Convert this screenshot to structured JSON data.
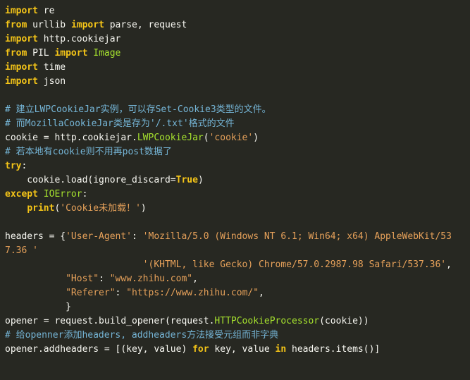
{
  "colors": {
    "background": "#272822",
    "default_text": "#f8f8f2",
    "keyword": "#f5c518",
    "string": "#e6a15a",
    "class_name": "#a6e22e",
    "comment": "#75b5d6"
  },
  "lines": [
    [
      {
        "t": "import",
        "c": "kw"
      },
      {
        "t": " re",
        "c": ""
      }
    ],
    [
      {
        "t": "from",
        "c": "kw"
      },
      {
        "t": " urllib ",
        "c": ""
      },
      {
        "t": "import",
        "c": "kw"
      },
      {
        "t": " parse, request",
        "c": ""
      }
    ],
    [
      {
        "t": "import",
        "c": "kw"
      },
      {
        "t": " http.cookiejar",
        "c": ""
      }
    ],
    [
      {
        "t": "from",
        "c": "kw"
      },
      {
        "t": " PIL ",
        "c": ""
      },
      {
        "t": "import",
        "c": "kw"
      },
      {
        "t": " ",
        "c": ""
      },
      {
        "t": "Image",
        "c": "fn"
      }
    ],
    [
      {
        "t": "import",
        "c": "kw"
      },
      {
        "t": " time",
        "c": ""
      }
    ],
    [
      {
        "t": "import",
        "c": "kw"
      },
      {
        "t": " json",
        "c": ""
      }
    ],
    [],
    [
      {
        "t": "# 建立LWPCookieJar实例，可以存Set-Cookie3类型的文件。",
        "c": "cmt"
      }
    ],
    [
      {
        "t": "# 而MozillaCookieJar类是存为'/.txt'格式的文件",
        "c": "cmt"
      }
    ],
    [
      {
        "t": "cookie = http.cookiejar.",
        "c": ""
      },
      {
        "t": "LWPCookieJar",
        "c": "fn"
      },
      {
        "t": "(",
        "c": ""
      },
      {
        "t": "'cookie'",
        "c": "str"
      },
      {
        "t": ")",
        "c": ""
      }
    ],
    [
      {
        "t": "# 若本地有cookie则不用再post数据了",
        "c": "cmt"
      }
    ],
    [
      {
        "t": "try",
        "c": "kw"
      },
      {
        "t": ":",
        "c": ""
      }
    ],
    [
      {
        "t": "    cookie.load(ignore_discard=",
        "c": ""
      },
      {
        "t": "True",
        "c": "const"
      },
      {
        "t": ")",
        "c": ""
      }
    ],
    [
      {
        "t": "except",
        "c": "kw"
      },
      {
        "t": " ",
        "c": ""
      },
      {
        "t": "IOError",
        "c": "fn"
      },
      {
        "t": ":",
        "c": ""
      }
    ],
    [
      {
        "t": "    ",
        "c": ""
      },
      {
        "t": "print",
        "c": "kw"
      },
      {
        "t": "(",
        "c": ""
      },
      {
        "t": "'Cookie未加载！'",
        "c": "str"
      },
      {
        "t": ")",
        "c": ""
      }
    ],
    [],
    [
      {
        "t": "headers = {",
        "c": ""
      },
      {
        "t": "'User-Agent'",
        "c": "str"
      },
      {
        "t": ": ",
        "c": ""
      },
      {
        "t": "'Mozilla/5.0 (Windows NT 6.1; Win64; x64) AppleWebKit/53",
        "c": "str"
      }
    ],
    [
      {
        "t": "7.36 '",
        "c": "str"
      }
    ],
    [
      {
        "t": "                         ",
        "c": ""
      },
      {
        "t": "'(KHTML, like Gecko) Chrome/57.0.2987.98 Safari/537.36'",
        "c": "str"
      },
      {
        "t": ",",
        "c": ""
      }
    ],
    [
      {
        "t": "           ",
        "c": ""
      },
      {
        "t": "\"Host\"",
        "c": "str"
      },
      {
        "t": ": ",
        "c": ""
      },
      {
        "t": "\"www.zhihu.com\"",
        "c": "str"
      },
      {
        "t": ",",
        "c": ""
      }
    ],
    [
      {
        "t": "           ",
        "c": ""
      },
      {
        "t": "\"Referer\"",
        "c": "str"
      },
      {
        "t": ": ",
        "c": ""
      },
      {
        "t": "\"https://www.zhihu.com/\"",
        "c": "str"
      },
      {
        "t": ",",
        "c": ""
      }
    ],
    [
      {
        "t": "           }",
        "c": ""
      }
    ],
    [
      {
        "t": "opener = request.build_opener(request.",
        "c": ""
      },
      {
        "t": "HTTPCookieProcessor",
        "c": "fn"
      },
      {
        "t": "(cookie))",
        "c": ""
      }
    ],
    [
      {
        "t": "# 给openner添加headers, addheaders方法接受元组而非字典",
        "c": "cmt"
      }
    ],
    [
      {
        "t": "opener.addheaders = [(key, value) ",
        "c": ""
      },
      {
        "t": "for",
        "c": "kw"
      },
      {
        "t": " key, value ",
        "c": ""
      },
      {
        "t": "in",
        "c": "kw"
      },
      {
        "t": " headers.items()]",
        "c": ""
      }
    ]
  ]
}
